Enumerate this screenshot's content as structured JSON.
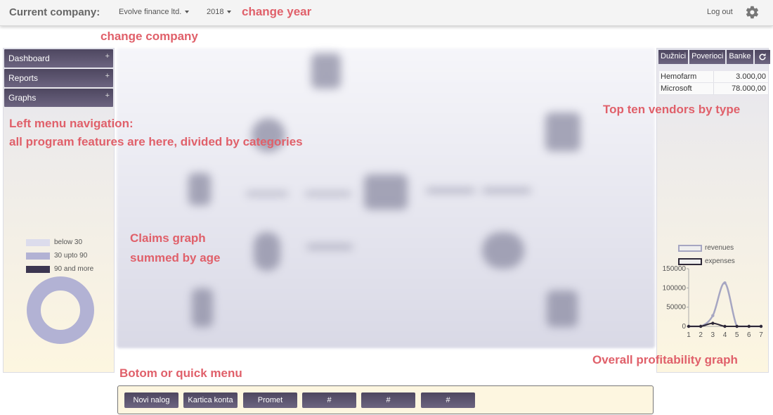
{
  "header": {
    "company_label": "Current company:",
    "company_value": "Evolve finance ltd.",
    "year_value": "2018",
    "logout_label": "Log out"
  },
  "annotations": {
    "change_year": "change year",
    "change_company": "change company",
    "left_menu_1": "Left menu navigation:",
    "left_menu_2": "all program features are here, divided by categories",
    "claims_1": "Claims graph",
    "claims_2": "summed by age",
    "top_ten": "Top ten vendors by type",
    "bottom_menu": "Botom or quick menu",
    "profitability": "Overall profitability graph"
  },
  "sidebar": {
    "items": [
      {
        "label": "Dashboard",
        "plus": "+"
      },
      {
        "label": "Reports",
        "plus": "+"
      },
      {
        "label": "Graphs",
        "plus": "+"
      }
    ]
  },
  "claims_legend": [
    {
      "label": "below 30",
      "color": "#dcdcec"
    },
    {
      "label": "30 upto 90",
      "color": "#b2b2d4"
    },
    {
      "label": "90 and more",
      "color": "#3c3650"
    }
  ],
  "right": {
    "tabs": [
      "Dužnici",
      "Poverioci",
      "Banke"
    ],
    "refresh_icon": "refresh-icon",
    "vendors": [
      {
        "name": "Hemofarm",
        "value": "3.000,00"
      },
      {
        "name": "Microsoft",
        "value": "78.000,00"
      }
    ]
  },
  "chart_data": [
    {
      "type": "pie",
      "labels": [
        "below 30",
        "30 upto 90",
        "90 and more"
      ],
      "values": [
        0,
        100,
        0
      ],
      "colors": [
        "#dcdcec",
        "#b2b2d4",
        "#3c3650"
      ]
    },
    {
      "type": "line",
      "x": [
        1,
        2,
        3,
        4,
        5,
        6,
        7
      ],
      "series": [
        {
          "name": "revenues",
          "values": [
            0,
            0,
            28000,
            113000,
            0,
            0,
            0
          ],
          "color": "#a6a6c2"
        },
        {
          "name": "expenses",
          "values": [
            0,
            0,
            8000,
            0,
            0,
            0,
            0
          ],
          "color": "#2e2838"
        }
      ],
      "yticks": [
        "0",
        "50000",
        "100000",
        "150000"
      ],
      "xticks": [
        "1",
        "2",
        "3",
        "4",
        "5",
        "6",
        "7"
      ],
      "ylim": [
        0,
        150000
      ]
    }
  ],
  "quick_menu": {
    "buttons": [
      "Novi nalog",
      "Kartica konta",
      "Promet",
      "#",
      "#",
      "#"
    ]
  }
}
